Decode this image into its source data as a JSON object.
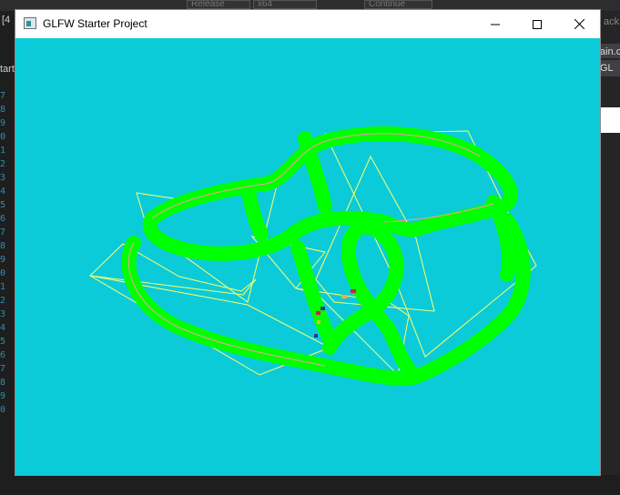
{
  "ide": {
    "config_label": "Release",
    "platform_label": "x64",
    "continue_label": "Continue",
    "back_label": "ack",
    "left_tab": "[4",
    "left_label": "tarte",
    "right_tab": "ain.c",
    "right_tab2": "GL",
    "line_numbers": [
      "7",
      "8",
      "9",
      "0",
      "1",
      "2",
      "3",
      "4",
      "5",
      "6",
      "7",
      "8",
      "9",
      "0",
      "1",
      "2",
      "3",
      "4",
      "5",
      "6",
      "7",
      "8",
      "9",
      "0"
    ]
  },
  "window": {
    "title": "GLFW Starter Project",
    "icons": {
      "app": "app-window-icon",
      "minimize": "minimize-icon",
      "maximize": "maximize-icon",
      "close": "close-icon"
    }
  },
  "scene": {
    "background_color": "#0ccbd9",
    "tube_color": "#00ff00",
    "frame_color": "#ffff66",
    "edge_color": "#ff9999",
    "marker_colors": [
      "#cc2244",
      "#333399",
      "#ffaa44"
    ]
  }
}
